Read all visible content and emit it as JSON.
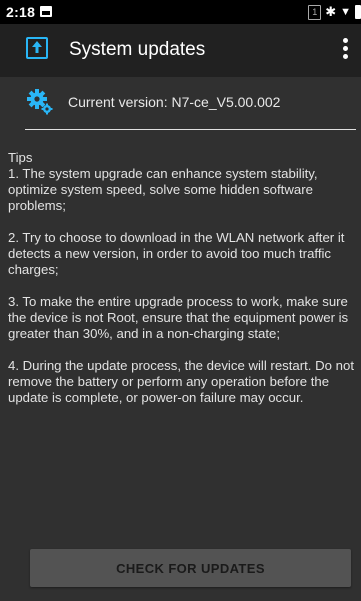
{
  "status_bar": {
    "time": "2:18",
    "sim_label": "1",
    "icons": [
      "notification-image-icon",
      "sim-icon",
      "bluetooth-icon",
      "wifi-icon",
      "battery-icon"
    ]
  },
  "app_bar": {
    "title": "System updates",
    "logo_icon": "update-arrow-icon",
    "menu_icon": "overflow-menu-icon",
    "accent_color": "#29b6f6"
  },
  "version": {
    "icon": "gear-icon",
    "text": "Current version: N7-ce_V5.00.002"
  },
  "tips": {
    "heading": "Tips",
    "items": [
      "1. The system upgrade can enhance system stability, optimize system speed, solve some hidden software problems;",
      " 2. Try to choose to download in the WLAN network after it detects a new version, in order to avoid too much traffic charges;",
      " 3. To make the entire upgrade process to work, make sure the device is not Root, ensure that the equipment power is greater than 30%, and in a non-charging state;",
      " 4. During the update process, the device will restart. Do not remove the battery or perform any operation before the update is complete, or power-on failure may occur."
    ]
  },
  "actions": {
    "check_label": "CHECK FOR UPDATES"
  }
}
